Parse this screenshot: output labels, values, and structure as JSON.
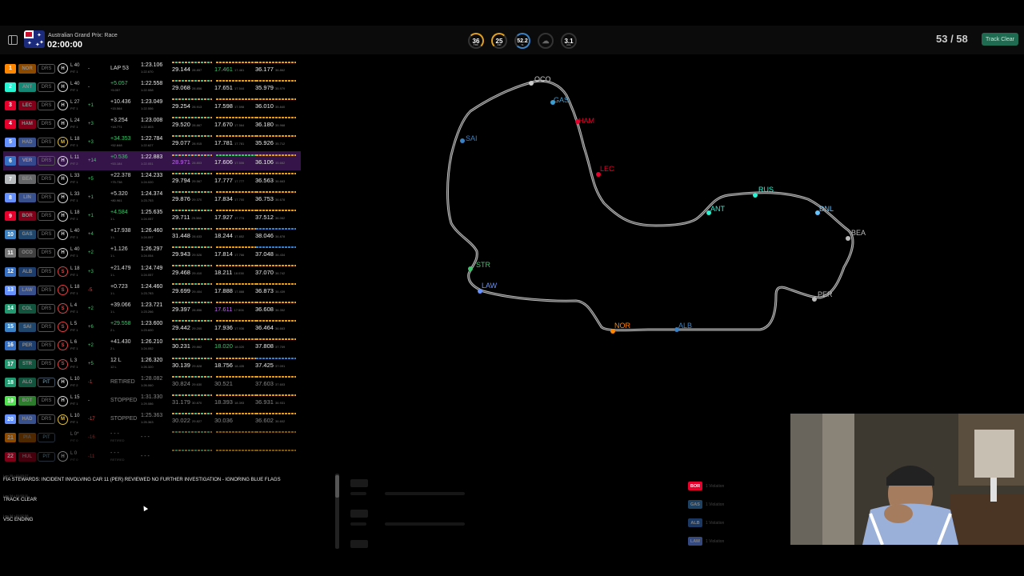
{
  "header": {
    "race_name": "Australian Grand Prix: Race",
    "race_clock": "02:00:00",
    "weather": [
      {
        "name": "track-temp",
        "value": "36",
        "unit": "TRC"
      },
      {
        "name": "air-temp",
        "value": "25",
        "unit": "AIR"
      },
      {
        "name": "humidity",
        "value": "52.2",
        "unit": "%"
      },
      {
        "name": "rain",
        "value": "",
        "unit": ""
      },
      {
        "name": "wind",
        "value": "3.1",
        "unit": "m/s"
      }
    ],
    "lap_counter": "53 / 58",
    "track_status": "Track Clear"
  },
  "colors": {
    "MCL": "#ff8700",
    "FER": "#e8002d",
    "MER": "#27f4d2",
    "RBR": "#3671c6",
    "AST": "#229971",
    "ALP": "#ff87bc",
    "WIL": "#64c4ff",
    "RB": "#6692ff",
    "SAU": "#52e252",
    "HAAS": "#b6babd"
  },
  "drivers": [
    {
      "pos": "1",
      "code": "NOR",
      "color": "#ff8700",
      "drs": "DRS",
      "tyre": "H",
      "tyre_class": "",
      "lap": "L 40",
      "pit": "PIT 1",
      "delta": "-",
      "dclass": "",
      "gap": "LAP 53",
      "gap_sub": "",
      "last": "1:23.106",
      "last_sub": "1:22.670",
      "s1": "29.144",
      "s1b": "28.857",
      "s2": "17.461",
      "s2b": "17.461",
      "s2c": "pb",
      "s3": "36.177",
      "s3b": "36.862"
    },
    {
      "pos": "2",
      "code": "ANT",
      "color": "#27f4d2",
      "drs": "DRS",
      "tyre": "H",
      "tyre_class": "",
      "lap": "L 40",
      "pit": "PIT 1",
      "delta": "-",
      "dclass": "",
      "gap": "+5.057",
      "gap_sub": "+5.057",
      "gclass": "gain",
      "last": "1:22.558",
      "last_sub": "1:22.558",
      "s1": "29.068",
      "s1b": "28.856",
      "s2": "17.651",
      "s2b": "17.544",
      "s3": "35.979",
      "s3b": "35.979"
    },
    {
      "pos": "3",
      "code": "LEC",
      "color": "#e8002d",
      "drs": "DRS",
      "tyre": "H",
      "tyre_class": "",
      "lap": "L 27",
      "pit": "PIT 1",
      "delta": "+1",
      "dclass": "up",
      "gap": "+10.436",
      "gap_sub": "+15.564",
      "last": "1:23.049",
      "last_sub": "1:22.556",
      "s1": "29.254",
      "s1b": "28.913",
      "s2": "17.598",
      "s2b": "17.598",
      "s3": "36.010",
      "s3b": "35.840"
    },
    {
      "pos": "4",
      "code": "HAM",
      "color": "#e8002d",
      "drs": "DRS",
      "tyre": "H",
      "tyre_class": "",
      "lap": "L 24",
      "pit": "PIT 1",
      "delta": "+3",
      "dclass": "up",
      "gap": "+3.254",
      "gap_sub": "+18.771",
      "last": "1:23.008",
      "last_sub": "1:22.803",
      "s1": "29.520",
      "s1b": "28.867",
      "s2": "17.670",
      "s2b": "17.564",
      "s3": "36.180",
      "s3b": "35.968"
    },
    {
      "pos": "5",
      "code": "HAD",
      "color": "#6692ff",
      "drs": "DRS",
      "tyre": "M",
      "tyre_class": "medium",
      "lap": "L 18",
      "pit": "PIT 1",
      "delta": "+3",
      "dclass": "up",
      "gap": "+34.353",
      "gap_sub": "+52.848",
      "gclass": "gain",
      "last": "1:22.784",
      "last_sub": "1:22.627",
      "s1": "29.077",
      "s1b": "28.915",
      "s2": "17.781",
      "s2b": "17.781",
      "s3": "35.926",
      "s3b": "35.712"
    },
    {
      "pos": "6",
      "code": "VER",
      "color": "#3671c6",
      "drs": "DRS",
      "tyre": "H",
      "tyre_class": "",
      "lap": "L 11",
      "pit": "PIT 2",
      "delta": "+14",
      "dclass": "up",
      "gap": "+0.536",
      "gap_sub": "+53.184",
      "gclass": "gain",
      "last": "1:22.883",
      "last_sub": "1:22.051",
      "s1": "28.971",
      "s1b": "28.803",
      "s1c": "ob",
      "s2": "17.606",
      "s2b": "17.506",
      "s3": "36.106",
      "s3b": "35.662",
      "highlight": true
    },
    {
      "pos": "7",
      "code": "BEA",
      "color": "#b6babd",
      "drs": "DRS",
      "tyre": "H",
      "tyre_class": "",
      "lap": "L 33",
      "pit": "PIT 1",
      "delta": "+5",
      "dclass": "up",
      "gap": "+22.378",
      "gap_sub": "+75.738",
      "last": "1:24.233",
      "last_sub": "1:24.020",
      "s1": "29.794",
      "s1b": "29.567",
      "s2": "17.777",
      "s2b": "17.777",
      "s3": "36.563",
      "s3b": "36.663"
    },
    {
      "pos": "8",
      "code": "LIN",
      "color": "#6692ff",
      "drs": "DRS",
      "tyre": "H",
      "tyre_class": "",
      "lap": "L 33",
      "pit": "PIT 1",
      "delta": "+1",
      "dclass": "up",
      "gap": "+5.320",
      "gap_sub": "+80.961",
      "last": "1:24.374",
      "last_sub": "1:23.753",
      "s1": "29.876",
      "s1b": "29.370",
      "s2": "17.834",
      "s2b": "17.700",
      "s3": "36.753",
      "s3b": "36.678"
    },
    {
      "pos": "9",
      "code": "BOR",
      "color": "#e8002d",
      "drs": "DRS",
      "tyre": "H",
      "tyre_class": "",
      "lap": "L 18",
      "pit": "PIT 1",
      "delta": "+1",
      "dclass": "up",
      "gap": "+4.584",
      "gap_sub": "1 L",
      "gclass": "gain",
      "last": "1:25.635",
      "last_sub": "1:24.057",
      "s1": "29.711",
      "s1b": "29.386",
      "s2": "17.927",
      "s2b": "17.774",
      "s3": "37.512",
      "s3b": "36.062"
    },
    {
      "pos": "10",
      "code": "GAS",
      "color": "#3b82c4",
      "drs": "DRS",
      "tyre": "H",
      "tyre_class": "",
      "lap": "L 40",
      "pit": "PIT 1",
      "delta": "+4",
      "dclass": "up",
      "gap": "+17.938",
      "gap_sub": "1 L",
      "last": "1:26.460",
      "last_sub": "1:24.057",
      "s1": "31.448",
      "s1b": "28.633",
      "s2": "18.244",
      "s2b": "17.852",
      "s3": "38.046",
      "s3b": "36.878"
    },
    {
      "pos": "11",
      "code": "OCO",
      "color": "#777777",
      "drs": "DRS",
      "tyre": "H",
      "tyre_class": "",
      "lap": "L 40",
      "pit": "PIT 1",
      "delta": "+2",
      "dclass": "up",
      "gap": "+1.126",
      "gap_sub": "1 L",
      "last": "1:26.297",
      "last_sub": "1:24.054",
      "s1": "29.943",
      "s1b": "29.526",
      "s2": "17.814",
      "s2b": "17.766",
      "s3": "37.048",
      "s3b": "36.434"
    },
    {
      "pos": "12",
      "code": "ALB",
      "color": "#3671c6",
      "drs": "DRS",
      "tyre": "S",
      "tyre_class": "soft",
      "lap": "L 18",
      "pit": "PIT 1",
      "delta": "+3",
      "dclass": "up",
      "gap": "+21.479",
      "gap_sub": "1 L",
      "last": "1:24.749",
      "last_sub": "1:24.057",
      "s1": "29.468",
      "s1b": "29.410",
      "s2": "18.211",
      "s2b": "18.038",
      "s3": "37.070",
      "s3b": "36.742"
    },
    {
      "pos": "13",
      "code": "LAW",
      "color": "#6692ff",
      "drs": "DRS",
      "tyre": "S",
      "tyre_class": "soft",
      "lap": "L 18",
      "pit": "PIT 1",
      "delta": "-5",
      "dclass": "down",
      "gap": "+0.723",
      "gap_sub": "1 L",
      "last": "1:24.460",
      "last_sub": "1:23.783",
      "s1": "29.699",
      "s1b": "29.404",
      "s2": "17.888",
      "s2b": "17.888",
      "s3": "36.873",
      "s3b": "36.439"
    },
    {
      "pos": "14",
      "code": "COL",
      "color": "#229971",
      "drs": "DRS",
      "tyre": "S",
      "tyre_class": "soft",
      "lap": "L 4",
      "pit": "PIT 1",
      "delta": "+2",
      "dclass": "up",
      "gap": "+39.066",
      "gap_sub": "1 L",
      "last": "1:23.721",
      "last_sub": "1:23.266",
      "s1": "29.397",
      "s1b": "28.856",
      "s2": "17.611",
      "s2b": "17.506",
      "s2c": "ob",
      "s3": "36.608",
      "s3b": "36.352"
    },
    {
      "pos": "15",
      "code": "SAI",
      "color": "#3b82c4",
      "drs": "DRS",
      "tyre": "S",
      "tyre_class": "soft",
      "lap": "L 5",
      "pit": "PIT 1",
      "delta": "+6",
      "dclass": "up",
      "gap": "+29.558",
      "gap_sub": "2 L",
      "gclass": "gain",
      "last": "1:23.600",
      "last_sub": "1:23.600",
      "s1": "29.442",
      "s1b": "29.200",
      "s2": "17.936",
      "s2b": "17.936",
      "s3": "36.464",
      "s3b": "36.663"
    },
    {
      "pos": "16",
      "code": "PER",
      "color": "#3671c6",
      "drs": "DRS",
      "tyre": "S",
      "tyre_class": "soft",
      "lap": "L 6",
      "pit": "PIT 1",
      "delta": "+2",
      "dclass": "up",
      "gap": "+41.430",
      "gap_sub": "2 L",
      "last": "1:26.210",
      "last_sub": "1:24.052",
      "s1": "30.231",
      "s1b": "29.862",
      "s2": "18.020",
      "s2b": "18.020",
      "s2c": "pb",
      "s3": "37.808",
      "s3b": "37.709"
    },
    {
      "pos": "17",
      "code": "STR",
      "color": "#229971",
      "drs": "DRS",
      "tyre": "S",
      "tyre_class": "soft",
      "lap": "L 3",
      "pit": "PIT 1",
      "delta": "+5",
      "dclass": "up",
      "gap": "12 L",
      "gap_sub": "12 L",
      "last": "1:26.320",
      "last_sub": "1:26.320",
      "s1": "30.139",
      "s1b": "29.828",
      "s2": "18.756",
      "s2b": "18.435",
      "s3": "37.425",
      "s3b": "37.091"
    },
    {
      "pos": "18",
      "code": "ALO",
      "color": "#229971",
      "drs": "PIT",
      "tyre": "H",
      "tyre_class": "",
      "lap": "L 10",
      "pit": "PIT 2",
      "delta": "-1",
      "dclass": "down",
      "gap": "RETIRED",
      "gap_sub": "",
      "last": "1:28.082",
      "last_sub": "1:26.060",
      "s1": "30.824",
      "s1b": "29.630",
      "s2": "30.521",
      "s2b": "",
      "s3": "37.603",
      "s3b": "37.603",
      "dim": true
    },
    {
      "pos": "19",
      "code": "BOT",
      "color": "#52e252",
      "drs": "DRS",
      "tyre": "H",
      "tyre_class": "",
      "lap": "L 15",
      "pit": "PIT 1",
      "delta": "-",
      "dclass": "",
      "gap": "STOPPED",
      "gap_sub": "",
      "last": "1:31.330",
      "last_sub": "1:29.086",
      "s1": "31.179",
      "s1b": "30.870",
      "s2": "18.393",
      "s2b": "18.393",
      "s3": "36.931",
      "s3b": "36.931",
      "dim": true
    },
    {
      "pos": "20",
      "code": "HAD",
      "color": "#6692ff",
      "drs": "DRS",
      "tyre": "M",
      "tyre_class": "medium",
      "lap": "L 10",
      "pit": "PIT 1",
      "delta": "-17",
      "dclass": "down",
      "gap": "STOPPED",
      "gap_sub": "",
      "last": "1:25.363",
      "last_sub": "1:25.363",
      "s1": "30.022",
      "s1b": "29.827",
      "s2": "30.036",
      "s2b": "",
      "s3": "36.602",
      "s3b": "36.602",
      "dim": true
    },
    {
      "pos": "21",
      "code": "PIA",
      "color": "#ff8700",
      "drs": "PIT",
      "tyre": "",
      "tyre_class": "",
      "lap": "L 0*",
      "pit": "PIT 0",
      "delta": "-16",
      "dclass": "down",
      "gap": "- - -",
      "gap_sub": "RETIRED",
      "last": "- - -",
      "last_sub": "",
      "s1": "",
      "s1b": "",
      "s2": "",
      "s2b": "",
      "s3": "",
      "s3b": "",
      "ghost": true
    },
    {
      "pos": "22",
      "code": "HUL",
      "color": "#e8002d",
      "drs": "PIT",
      "tyre": "H",
      "tyre_class": "",
      "lap": "L 0",
      "pit": "PIT 0",
      "delta": "-11",
      "dclass": "down",
      "gap": "- - -",
      "gap_sub": "RETIRED",
      "last": "- - -",
      "last_sub": "",
      "s1": "",
      "s1b": "",
      "s2": "",
      "s2b": "",
      "s3": "",
      "s3b": "",
      "ghost": true
    }
  ],
  "track_labels": [
    {
      "code": "OCO",
      "color": "#cccccc"
    },
    {
      "code": "GAS",
      "color": "#3b9fd4"
    },
    {
      "code": "HAM",
      "color": "#e8002d"
    },
    {
      "code": "SAI",
      "color": "#3b82c4"
    },
    {
      "code": "LEC",
      "color": "#e8002d"
    },
    {
      "code": "RUS",
      "color": "#27f4d2"
    },
    {
      "code": "ANT",
      "color": "#27f4d2"
    },
    {
      "code": "DNL",
      "color": "#64c4ff"
    },
    {
      "code": "BEA",
      "color": "#bbbbbb"
    },
    {
      "code": "STR",
      "color": "#3fc56b"
    },
    {
      "code": "LAW",
      "color": "#6692ff"
    },
    {
      "code": "PER",
      "color": "#bbbbbb"
    },
    {
      "code": "NOR",
      "color": "#ff8700"
    },
    {
      "code": "ALB",
      "color": "#3b82c4"
    }
  ],
  "race_control": [
    {
      "meta": "Lap 35 • 01:53:27",
      "text": "FIA STEWARDS: INCIDENT INVOLVING CAR 11 (PER) REVIEWED NO FURTHER INVESTIGATION - IGNORING BLUE FLAGS"
    },
    {
      "meta": "Lap 34 • 01:53:11",
      "text": "TRACK CLEAR"
    },
    {
      "meta": "Lap 34 • 01:52:58",
      "text": "VSC ENDING"
    }
  ],
  "violations": [
    {
      "code": "BOR",
      "color": "#e8002d",
      "text": "1 Violation"
    },
    {
      "code": "GAS",
      "color": "#3b82c4",
      "text": "1 Violation"
    },
    {
      "code": "ALB",
      "color": "#3671c6",
      "text": "1 Violation"
    },
    {
      "code": "LAW",
      "color": "#6692ff",
      "text": "1 Violation"
    }
  ]
}
